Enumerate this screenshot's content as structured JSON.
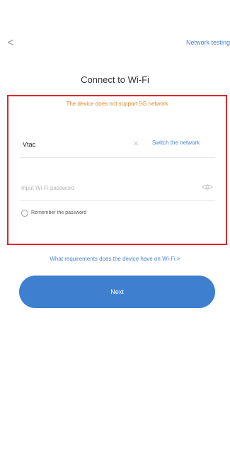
{
  "header": {
    "back_glyph": "<",
    "network_testing_label": "Network testing"
  },
  "page_title": "Connect to Wi-Fi",
  "warning_text": "The device does not support 5G network",
  "wifi": {
    "ssid": "Vtac",
    "clear_glyph": "×",
    "switch_label": "Switch the network"
  },
  "password": {
    "placeholder": "Input Wi-Fi password",
    "value": ""
  },
  "remember": {
    "label": "Remember the password",
    "checked": false
  },
  "requirements_link": "What requirements does the device have on Wi-Fi >",
  "next_button_label": "Next",
  "colors": {
    "accent": "#3f7fd0",
    "link": "#4b84d6",
    "warning": "#e4891f",
    "highlight_frame": "#e0252b"
  }
}
